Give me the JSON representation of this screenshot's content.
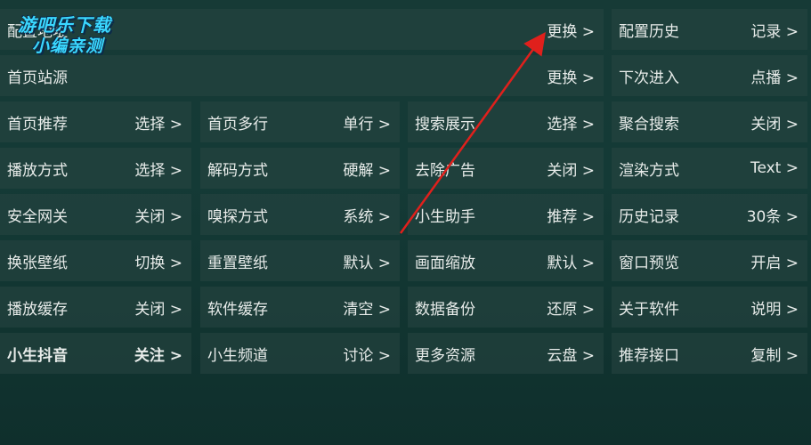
{
  "rows": [
    [
      {
        "label": "配置地址",
        "value": "更换 >",
        "span": 3
      },
      {
        "label": "配置历史",
        "value": "记录 >"
      }
    ],
    [
      {
        "label": "首页站源",
        "value": "更换 >",
        "span": 3
      },
      {
        "label": "下次进入",
        "value": "点播 >"
      }
    ],
    [
      {
        "label": "首页推荐",
        "value": "选择 >"
      },
      {
        "label": "首页多行",
        "value": "单行 >"
      },
      {
        "label": "搜索展示",
        "value": "选择 >"
      },
      {
        "label": "聚合搜索",
        "value": "关闭 >"
      }
    ],
    [
      {
        "label": "播放方式",
        "value": "选择 >"
      },
      {
        "label": "解码方式",
        "value": "硬解 >"
      },
      {
        "label": "去除广告",
        "value": "关闭 >"
      },
      {
        "label": "渲染方式",
        "value": "Text >"
      }
    ],
    [
      {
        "label": "安全网关",
        "value": "关闭 >"
      },
      {
        "label": "嗅探方式",
        "value": "系统 >"
      },
      {
        "label": "小生助手",
        "value": "推荐 >"
      },
      {
        "label": "历史记录",
        "value": "30条 >"
      }
    ],
    [
      {
        "label": "换张壁纸",
        "value": "切换 >"
      },
      {
        "label": "重置壁纸",
        "value": "默认 >"
      },
      {
        "label": "画面缩放",
        "value": "默认 >"
      },
      {
        "label": "窗口预览",
        "value": "开启 >"
      }
    ],
    [
      {
        "label": "播放缓存",
        "value": "关闭 >"
      },
      {
        "label": "软件缓存",
        "value": "清空 >"
      },
      {
        "label": "数据备份",
        "value": "还原 >"
      },
      {
        "label": "关于软件",
        "value": "说明 >"
      }
    ],
    [
      {
        "label": "小生抖音",
        "value": "关注 >",
        "bold": true
      },
      {
        "label": "小生频道",
        "value": "讨论 >"
      },
      {
        "label": "更多资源",
        "value": "云盘 >"
      },
      {
        "label": "推荐接口",
        "value": "复制 >"
      }
    ]
  ],
  "watermark": {
    "line1": "游吧乐下载",
    "line2": "小编亲测"
  },
  "colors": {
    "arrow": "#e0201c",
    "watermark": "#3ad7ff"
  }
}
